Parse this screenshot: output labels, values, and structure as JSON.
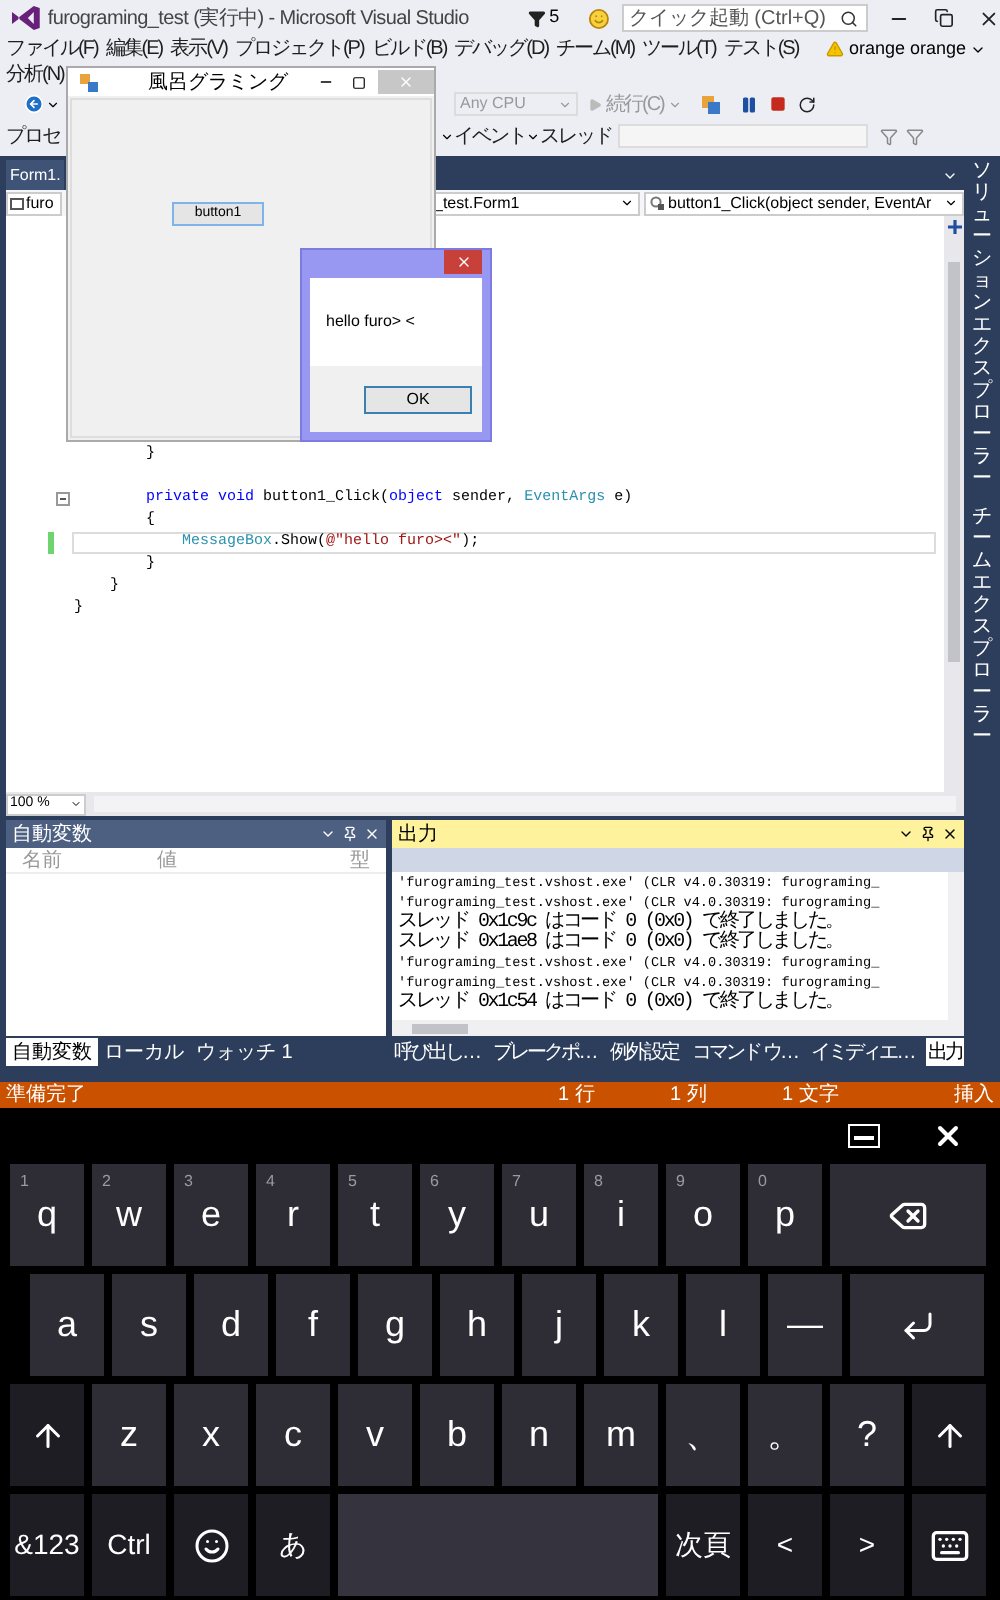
{
  "window": {
    "title": "furograming_test (実行中) - Microsoft Visual Studio",
    "notification_count": "5",
    "quick_launch": {
      "placeholder": "クイック起動 (Ctrl+Q)"
    }
  },
  "menu": [
    "ファイル(F)",
    "編集(E)",
    "表示(V)",
    "プロジェクト(P)",
    "ビルド(B)",
    "デバッグ(D)",
    "チーム(M)",
    "ツール(T)",
    "テスト(S)",
    "分析(N)"
  ],
  "account": {
    "name": "orange orange",
    "warning": true
  },
  "toolbars": {
    "process": "プロセ",
    "platform": "Any CPU",
    "continue": "続行(C)",
    "event": "イベント",
    "thread": "スレッド"
  },
  "editor": {
    "tab": "Form1.",
    "project_dropdown": "furo",
    "class_dropdown": "_test.Form1",
    "member_dropdown": "button1_Click(object sender, EventAr",
    "zoom": "100 %",
    "lines": [
      {
        "kind": "code",
        "tokens": [
          {
            "kind": "plain",
            "text": "        }"
          }
        ],
        "foldable": false,
        "changed": false,
        "current": false
      },
      {
        "kind": "blank"
      },
      {
        "kind": "code",
        "tokens": [
          {
            "kind": "keyword",
            "text": "        private void"
          },
          {
            "kind": "plain",
            "text": " button1_Click("
          },
          {
            "kind": "keyword",
            "text": "object"
          },
          {
            "kind": "plain",
            "text": " sender, "
          },
          {
            "kind": "type",
            "text": "EventArgs"
          },
          {
            "kind": "plain",
            "text": " e)"
          }
        ],
        "foldable": true,
        "changed": false,
        "current": false
      },
      {
        "kind": "code",
        "tokens": [
          {
            "kind": "plain",
            "text": "        {"
          }
        ],
        "foldable": false,
        "changed": false,
        "current": false
      },
      {
        "kind": "code",
        "tokens": [
          {
            "kind": "type",
            "text": "            MessageBox"
          },
          {
            "kind": "plain",
            "text": ".Show("
          },
          {
            "kind": "string",
            "text": "@\"hello furo><\""
          },
          {
            "kind": "plain",
            "text": ");"
          }
        ],
        "foldable": false,
        "changed": true,
        "current": true
      },
      {
        "kind": "code",
        "tokens": [
          {
            "kind": "plain",
            "text": "        }"
          }
        ],
        "foldable": false,
        "changed": false,
        "current": false
      },
      {
        "kind": "code",
        "tokens": [
          {
            "kind": "plain",
            "text": "    }"
          }
        ],
        "foldable": false,
        "changed": false,
        "current": false
      },
      {
        "kind": "code",
        "tokens": [
          {
            "kind": "plain",
            "text": "}"
          }
        ],
        "foldable": false,
        "changed": false,
        "current": false
      }
    ]
  },
  "form_window": {
    "title": "風呂グラミング",
    "button": "button1"
  },
  "message_box": {
    "text": "hello furo> <",
    "button": "OK"
  },
  "side_tabs": [
    "ソリューションエクスプローラー",
    "チームエクスプローラー"
  ],
  "autos_panel": {
    "title": "自動変数",
    "columns": [
      "名前",
      "値",
      "型"
    ],
    "tabs": [
      {
        "label": "自動変数",
        "selected": true
      },
      {
        "label": "ローカル",
        "selected": false
      },
      {
        "label": "ウォッチ 1",
        "selected": false
      }
    ]
  },
  "output_panel": {
    "title": "出力",
    "lines": [
      {
        "kind": "load",
        "text": "'furograming_test.vshost.exe' (CLR v4.0.30319: furograming_"
      },
      {
        "kind": "load",
        "text": "'furograming_test.vshost.exe' (CLR v4.0.30319: furograming_"
      },
      {
        "kind": "thread",
        "text": "スレッド 0x1c9c はコード 0 (0x0) で終了しました。"
      },
      {
        "kind": "thread",
        "text": "スレッド 0x1ae8 はコード 0 (0x0) で終了しました。"
      },
      {
        "kind": "load",
        "text": "'furograming_test.vshost.exe' (CLR v4.0.30319: furograming_"
      },
      {
        "kind": "load",
        "text": "'furograming_test.vshost.exe' (CLR v4.0.30319: furograming_"
      },
      {
        "kind": "thread",
        "text": "スレッド 0x1c54 はコード 0 (0x0) で終了しました。"
      }
    ],
    "tabs": [
      {
        "label": "呼び出し…",
        "selected": false
      },
      {
        "label": "ブレークポ…",
        "selected": false
      },
      {
        "label": "例外設定",
        "selected": false
      },
      {
        "label": "コマンド ウ…",
        "selected": false
      },
      {
        "label": "イミディエ…",
        "selected": false
      },
      {
        "label": "出力",
        "selected": true
      }
    ]
  },
  "status_bar": {
    "state": "準備完了",
    "line": "1 行",
    "column": "1 列",
    "char": "1 文字",
    "mode": "挿入"
  },
  "keyboard": {
    "rows": [
      {
        "keys": [
          {
            "kind": "char",
            "label": "q",
            "hint": "1"
          },
          {
            "kind": "char",
            "label": "w",
            "hint": "2"
          },
          {
            "kind": "char",
            "label": "e",
            "hint": "3"
          },
          {
            "kind": "char",
            "label": "r",
            "hint": "4"
          },
          {
            "kind": "char",
            "label": "t",
            "hint": "5"
          },
          {
            "kind": "char",
            "label": "y",
            "hint": "6"
          },
          {
            "kind": "char",
            "label": "u",
            "hint": "7"
          },
          {
            "kind": "char",
            "label": "i",
            "hint": "8"
          },
          {
            "kind": "char",
            "label": "o",
            "hint": "9"
          },
          {
            "kind": "char",
            "label": "p",
            "hint": "0"
          },
          {
            "kind": "backspace"
          }
        ]
      },
      {
        "keys": [
          {
            "kind": "char",
            "label": "a"
          },
          {
            "kind": "char",
            "label": "s"
          },
          {
            "kind": "char",
            "label": "d"
          },
          {
            "kind": "char",
            "label": "f"
          },
          {
            "kind": "char",
            "label": "g"
          },
          {
            "kind": "char",
            "label": "h"
          },
          {
            "kind": "char",
            "label": "j"
          },
          {
            "kind": "char",
            "label": "k"
          },
          {
            "kind": "char",
            "label": "l"
          },
          {
            "kind": "char",
            "label": "—"
          },
          {
            "kind": "enter"
          }
        ]
      },
      {
        "keys": [
          {
            "kind": "shift"
          },
          {
            "kind": "char",
            "label": "z"
          },
          {
            "kind": "char",
            "label": "x"
          },
          {
            "kind": "char",
            "label": "c"
          },
          {
            "kind": "char",
            "label": "v"
          },
          {
            "kind": "char",
            "label": "b"
          },
          {
            "kind": "char",
            "label": "n"
          },
          {
            "kind": "char",
            "label": "m"
          },
          {
            "kind": "char",
            "label": "、"
          },
          {
            "kind": "char",
            "label": "。"
          },
          {
            "kind": "char",
            "label": "?"
          },
          {
            "kind": "shift"
          }
        ]
      },
      {
        "keys": [
          {
            "kind": "fn",
            "label": "&123"
          },
          {
            "kind": "fn",
            "label": "Ctrl"
          },
          {
            "kind": "emoji"
          },
          {
            "kind": "fn",
            "label": "あ"
          },
          {
            "kind": "space"
          },
          {
            "kind": "dim",
            "label": "次頁"
          },
          {
            "kind": "fn",
            "label": "<"
          },
          {
            "kind": "fn",
            "label": ">"
          },
          {
            "kind": "keyboard"
          }
        ]
      }
    ]
  }
}
